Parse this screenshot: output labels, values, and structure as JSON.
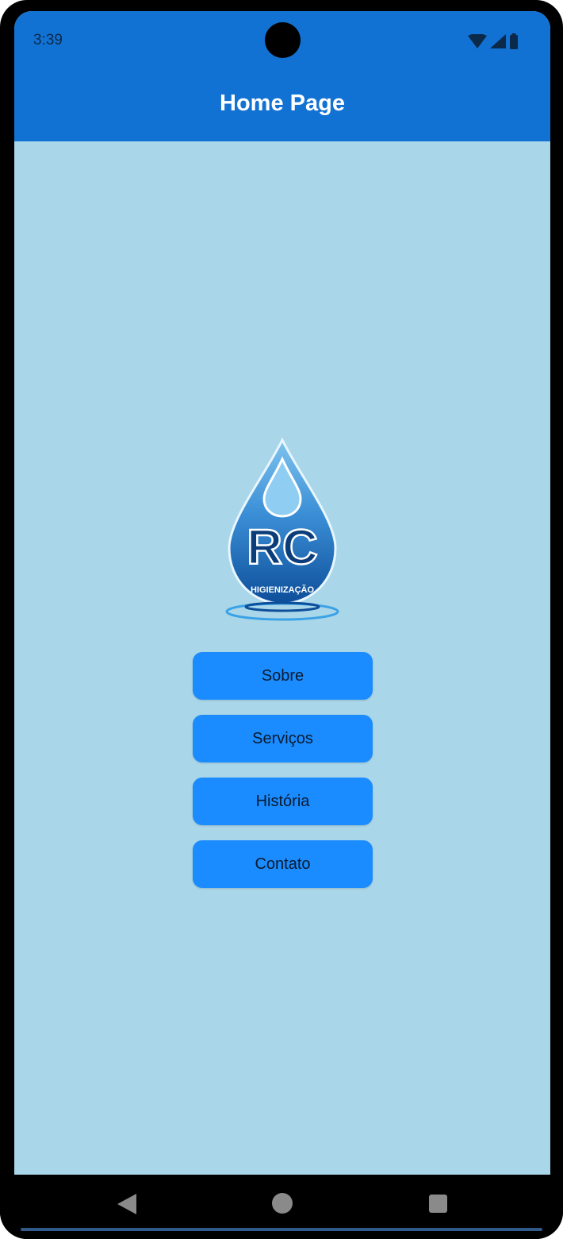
{
  "status_bar": {
    "time": "3:39",
    "icons": [
      "wifi-icon",
      "signal-icon",
      "battery-icon"
    ]
  },
  "app_bar": {
    "title": "Home Page",
    "color": "#1272d3"
  },
  "logo": {
    "text_main": "RC",
    "text_sub": "HIGIENIZAÇÃO"
  },
  "menu": {
    "buttons": [
      {
        "label": "Sobre"
      },
      {
        "label": "Serviços"
      },
      {
        "label": "História"
      },
      {
        "label": "Contato"
      }
    ],
    "button_color": "#1a8cff"
  },
  "background_color": "#a9d6e8",
  "nav_bar": {
    "icons": [
      "back-icon",
      "home-icon",
      "recents-icon"
    ]
  }
}
